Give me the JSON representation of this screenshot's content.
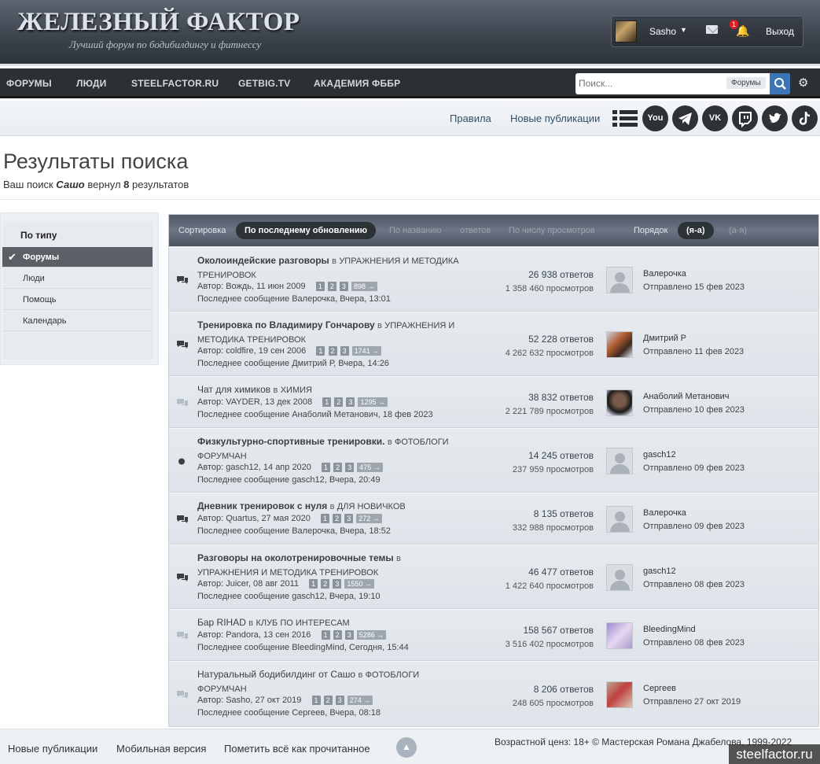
{
  "header": {
    "logo_title": "ЖЕЛЕЗНЫЙ ФАКТОР",
    "logo_subtitle": "Лучший форум по бодибилдингу и фитнессу",
    "user": {
      "name": "Sasho",
      "notification_count": "1",
      "logout_label": "Выход"
    }
  },
  "nav": {
    "items": [
      "ФОРУМЫ",
      "ЛЮДИ",
      "STEELFACTOR.RU",
      "GETBIG.TV",
      "АКАДЕМИЯ ФББР"
    ],
    "search": {
      "placeholder": "Поиск...",
      "scope": "Форумы"
    }
  },
  "subnav": {
    "links": [
      "Правила",
      "Новые публикации"
    ],
    "social_icons": [
      "youtube-icon",
      "telegram-icon",
      "vk-icon",
      "twitch-icon",
      "twitter-icon",
      "tiktok-icon"
    ]
  },
  "page": {
    "title": "Результаты поиска",
    "desc_prefix": "Ваш поиск ",
    "query": "Сашо",
    "desc_mid": " вернул ",
    "count": "8",
    "desc_suffix": " результатов"
  },
  "sidebar": {
    "heading": "По типу",
    "items": [
      "Форумы",
      "Люди",
      "Помощь",
      "Календарь"
    ],
    "active": "Форумы"
  },
  "sortbar": {
    "sort_label": "Сортировка",
    "active_sort": "По последнему обновлению",
    "options": [
      "По названию",
      "ответов",
      "По числу просмотров"
    ],
    "order_label": "Порядок",
    "active_order": "(я-а)",
    "order_alt": "(а-я)"
  },
  "results": [
    {
      "title": "Околоиндейские разговоры",
      "in": "в",
      "forum": "УПРАЖНЕНИЯ И МЕТОДИКА ТРЕНИРОВОК",
      "author_meta": "Автор: Вождь, 11 июн 2009",
      "pages": [
        "1",
        "2",
        "3",
        "898 →"
      ],
      "last": "Последнее сообщение Валерочка, Вчера, 13:01",
      "replies": "26 938 ответов",
      "views": "1 358 460 просмотров",
      "last_author": "Валерочка",
      "sent": "Отправлено 15 фев 2023",
      "unread": true
    },
    {
      "title": "Тренировка по Владимиру Гончарову",
      "in": "в",
      "forum": "УПРАЖНЕНИЯ И МЕТОДИКА ТРЕНИРОВОК",
      "author_meta": "Автор: coldfire, 19 сен 2006",
      "pages": [
        "1",
        "2",
        "3",
        "1741 →"
      ],
      "last": "Последнее сообщение Дмитрий Р, Вчера, 14:26",
      "replies": "52 228 ответов",
      "views": "4 262 632 просмотров",
      "last_author": "Дмитрий Р",
      "sent": "Отправлено 11 фев 2023",
      "unread": true
    },
    {
      "title": "Чат для химиков",
      "in": "в",
      "forum": "ХИМИЯ",
      "author_meta": "Автор: VAYDER, 13 дек 2008",
      "pages": [
        "1",
        "2",
        "3",
        "1295 →"
      ],
      "last": "Последнее сообщение Анаболий Метанович, 18 фев 2023",
      "replies": "38 832 ответов",
      "views": "2 221 789 просмотров",
      "last_author": "Анаболий Метанович",
      "sent": "Отправлено 10 фев 2023",
      "unread": false
    },
    {
      "title": "Физкультурно-спортивные тренировки.",
      "in": "в",
      "forum": "ФОТОБЛОГИ ФОРУМЧАН",
      "author_meta": "Автор: gasch12, 14 апр 2020",
      "pages": [
        "1",
        "2",
        "3",
        "475 →"
      ],
      "last": "Последнее сообщение gasch12, Вчера, 20:49",
      "replies": "14 245 ответов",
      "views": "237 959 просмотров",
      "last_author": "gasch12",
      "sent": "Отправлено 09 фев 2023",
      "unread": true
    },
    {
      "title": "Дневник тренировок с нуля",
      "in": "в",
      "forum": "ДЛЯ НОВИЧКОВ",
      "author_meta": "Автор: Quartus, 27 мая 2020",
      "pages": [
        "1",
        "2",
        "3",
        "272 →"
      ],
      "last": "Последнее сообщение Валерочка, Вчера, 18:52",
      "replies": "8 135 ответов",
      "views": "332 988 просмотров",
      "last_author": "Валерочка",
      "sent": "Отправлено 09 фев 2023",
      "unread": true
    },
    {
      "title": "Разговоры на околотренировочные темы",
      "in": "в",
      "forum": "УПРАЖНЕНИЯ И МЕТОДИКА ТРЕНИРОВОК",
      "author_meta": "Автор: Juicer, 08 авг 2011",
      "pages": [
        "1",
        "2",
        "3",
        "1550 →"
      ],
      "last": "Последнее сообщение gasch12, Вчера, 19:10",
      "replies": "46 477 ответов",
      "views": "1 422 640 просмотров",
      "last_author": "gasch12",
      "sent": "Отправлено 08 фев 2023",
      "unread": true
    },
    {
      "title": "Бар RIHAD",
      "in": "в",
      "forum": "КЛУБ ПО ИНТЕРЕСАМ",
      "author_meta": "Автор: Pandora, 13 сен 2016",
      "pages": [
        "1",
        "2",
        "3",
        "5286 →"
      ],
      "last": "Последнее сообщение BleedingMind, Сегодня, 15:44",
      "replies": "158 567 ответов",
      "views": "3 516 402 просмотров",
      "last_author": "BleedingMind",
      "sent": "Отправлено 08 фев 2023",
      "unread": false
    },
    {
      "title": "Натуральный бодибилдинг от Сашо",
      "in": "в",
      "forum": "ФОТОБЛОГИ ФОРУМЧАН",
      "author_meta": "Автор: Sasho, 27 окт 2019",
      "pages": [
        "1",
        "2",
        "3",
        "274 →"
      ],
      "last": "Последнее сообщение Сергеев, Вчера, 08:18",
      "replies": "8 206 ответов",
      "views": "248 605 просмотров",
      "last_author": "Сергеев",
      "sent": "Отправлено 27 окт 2019",
      "unread": false
    }
  ],
  "footer": {
    "links": [
      "Новые публикации",
      "Мобильная версия",
      "Пометить всё как прочитанное"
    ],
    "copyright": "Возрастной ценз: 18+  © Мастерская Романа Джабелова, 1999-2022"
  },
  "watermark": "steelfactor.ru"
}
